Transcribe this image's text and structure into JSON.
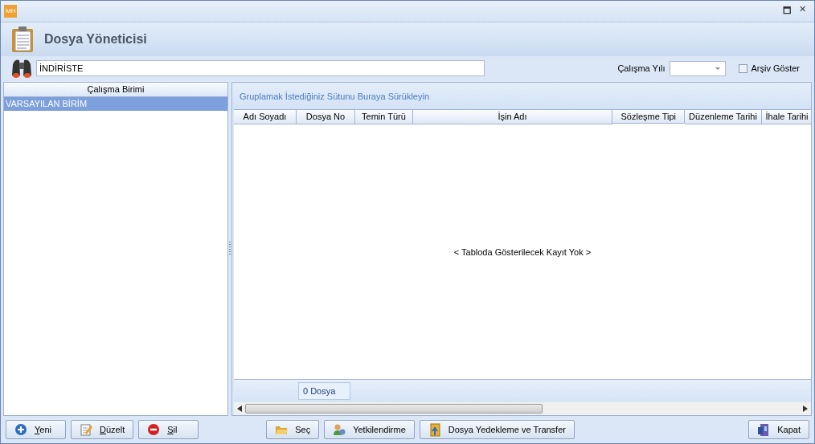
{
  "window": {
    "logo": "MH",
    "title": "Dosya Yöneticisi",
    "controls": [
      "🗖",
      "✕"
    ]
  },
  "search": {
    "value": "İNDİRİSTE"
  },
  "year_filter": {
    "label": "Çalışma Yılı"
  },
  "archive": {
    "label": "Arşiv Göster",
    "checked": false
  },
  "units": {
    "header": "Çalışma Birimi",
    "items": [
      {
        "label": "VARSAYILAN BİRİM",
        "selected": true
      }
    ]
  },
  "grid": {
    "group_hint": "Gruplamak İstediğiniz Sütunu Buraya Sürükleyin",
    "columns": [
      "Adı Soyadı",
      "Dosya No",
      "Temin Türü",
      "İşin Adı",
      "Sözleşme Tipi",
      "Düzenleme Tarihi",
      "İhale Tarihi"
    ],
    "empty_text": "< Tabloda Gösterilecek Kayıt Yok >",
    "footer_count": "0 Dosya"
  },
  "buttons_left": [
    {
      "label": "Yeni",
      "kind": "plus",
      "mnemonic": true
    },
    {
      "label": "Düzelt",
      "kind": "edit",
      "mnemonic": true
    },
    {
      "label": "Sil",
      "kind": "minus",
      "mnemonic": true
    }
  ],
  "buttons_center": [
    {
      "label": "Seç",
      "kind": "folder",
      "mnemonic": false
    },
    {
      "label": "Yetkilendirme",
      "kind": "user",
      "mnemonic": false
    },
    {
      "label": "Dosya Yedekleme ve Transfer",
      "kind": "backup",
      "mnemonic": false
    }
  ],
  "buttons_right": [
    {
      "label": "Kapat",
      "kind": "door",
      "mnemonic": false
    }
  ]
}
